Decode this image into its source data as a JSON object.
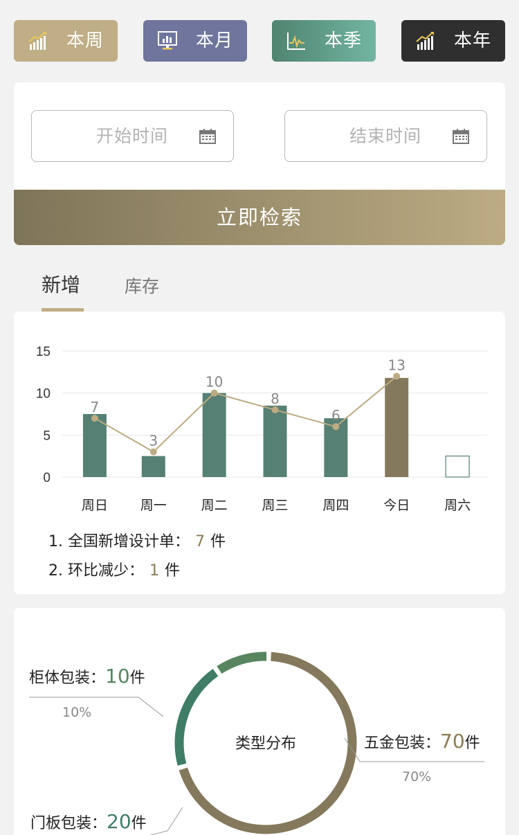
{
  "period_tabs": [
    {
      "label": "本周",
      "icon": "bar-growth-icon",
      "color": "#bfae86"
    },
    {
      "label": "本月",
      "icon": "monitor-chart-icon",
      "color": "#6f759c"
    },
    {
      "label": "本季",
      "icon": "line-wave-icon",
      "color": "#4f8470"
    },
    {
      "label": "本年",
      "icon": "bar-growth-icon",
      "color": "#2f2f2f"
    }
  ],
  "search": {
    "start_placeholder": "开始时间",
    "end_placeholder": "结束时间",
    "button_label": "立即检索"
  },
  "content_tabs": [
    {
      "label": "新增",
      "active": true
    },
    {
      "label": "库存",
      "active": false
    }
  ],
  "chart_data": {
    "type": "bar",
    "categories": [
      "周日",
      "周一",
      "周二",
      "周三",
      "周四",
      "今日",
      "周六"
    ],
    "values": [
      7.5,
      2.5,
      10,
      8.5,
      7,
      11.8,
      2.5
    ],
    "line_values": [
      7,
      3,
      10,
      8,
      6,
      13,
      null
    ],
    "line_labels": [
      "7",
      "3",
      "10",
      "8",
      "6",
      "13",
      ""
    ],
    "yticks": [
      "0",
      "5",
      "10",
      "15"
    ],
    "ylim": [
      0,
      15
    ],
    "colors": {
      "bar": "#568073",
      "today": "#84795c",
      "line": "#bcab83",
      "label": "#888"
    },
    "today_index": 5,
    "empty_index": 6
  },
  "notes": [
    {
      "index": "1.",
      "text": "全国新增设计单：",
      "value": "7",
      "unit": "件"
    },
    {
      "index": "2.",
      "text": "环比减少：",
      "value": "1",
      "unit": "件"
    }
  ],
  "pie": {
    "center_label": "类型分布",
    "slices": [
      {
        "name": "柜体包装：",
        "value": "10",
        "unit": "件",
        "pct": "10%",
        "share": 0.1,
        "color": "#568560",
        "value_color": "#568560"
      },
      {
        "name": "门板包装：",
        "value": "20",
        "unit": "件",
        "pct": "20%",
        "share": 0.2,
        "color": "#3f7d66",
        "value_color": "#3f7d66"
      },
      {
        "name": "五金包装：",
        "value": "70",
        "unit": "件",
        "pct": "70%",
        "share": 0.7,
        "color": "#84795c",
        "value_color": "#8a7c57"
      }
    ]
  }
}
